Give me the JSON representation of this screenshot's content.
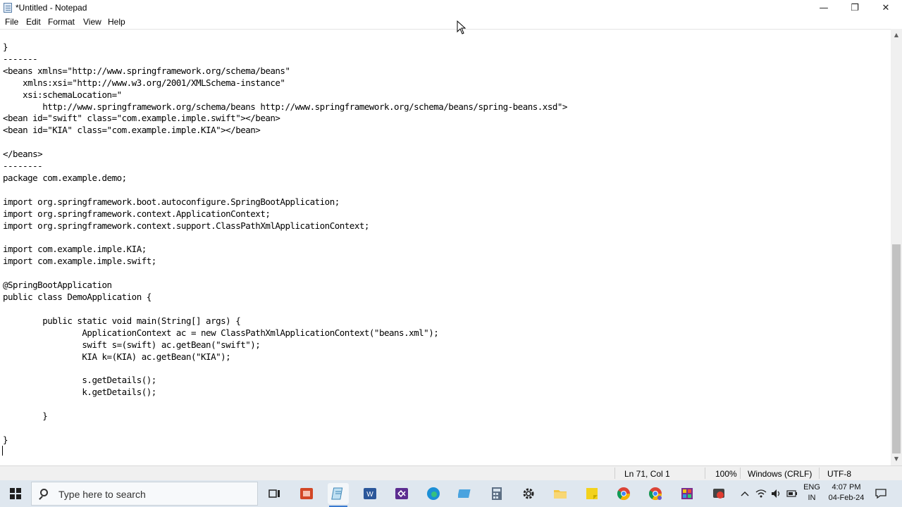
{
  "window": {
    "title": "*Untitled - Notepad",
    "buttons": {
      "minimize": "—",
      "maximize": "❐",
      "close": "✕"
    }
  },
  "menu": [
    "File",
    "Edit",
    "Format",
    "View",
    "Help"
  ],
  "editor": {
    "content": "}\n-------\n<beans xmlns=\"http://www.springframework.org/schema/beans\"\n    xmlns:xsi=\"http://www.w3.org/2001/XMLSchema-instance\"\n    xsi:schemaLocation=\"\n        http://www.springframework.org/schema/beans http://www.springframework.org/schema/beans/spring-beans.xsd\">\n<bean id=\"swift\" class=\"com.example.imple.swift\"></bean>\n<bean id=\"KIA\" class=\"com.example.imple.KIA\"></bean>\n\n</beans>\n--------\npackage com.example.demo;\n\nimport org.springframework.boot.autoconfigure.SpringBootApplication;\nimport org.springframework.context.ApplicationContext;\nimport org.springframework.context.support.ClassPathXmlApplicationContext;\n\nimport com.example.imple.KIA;\nimport com.example.imple.swift;\n\n@SpringBootApplication\npublic class DemoApplication {\n\n        public static void main(String[] args) {\n                ApplicationContext ac = new ClassPathXmlApplicationContext(\"beans.xml\");\n                swift s=(swift) ac.getBean(\"swift\");\n                KIA k=(KIA) ac.getBean(\"KIA\");\n\n                s.getDetails();\n                k.getDetails();\n\n        }\n\n}"
  },
  "status": {
    "position": "Ln 71, Col 1",
    "zoom": "100%",
    "line_ending": "Windows (CRLF)",
    "encoding": "UTF-8"
  },
  "taskbar": {
    "search_placeholder": "Type here to search",
    "icons": [
      "task-view-icon",
      "presentation-app-icon",
      "notepad-icon",
      "word-icon",
      "visual-studio-icon",
      "edge-icon",
      "photos-icon",
      "calculator-icon",
      "settings-icon",
      "file-explorer-icon",
      "sticky-notes-icon",
      "chrome-icon",
      "chrome-profile-icon",
      "archive-app-icon",
      "media-app-icon"
    ],
    "language": {
      "line1": "ENG",
      "line2": "IN"
    },
    "clock": {
      "time": "4:07 PM",
      "date": "04-Feb-24"
    }
  },
  "colors": {
    "taskbar_bg": "#dfe7ef",
    "accent": "#3a7ad0",
    "statusbar_bg": "#f0f0f0"
  }
}
